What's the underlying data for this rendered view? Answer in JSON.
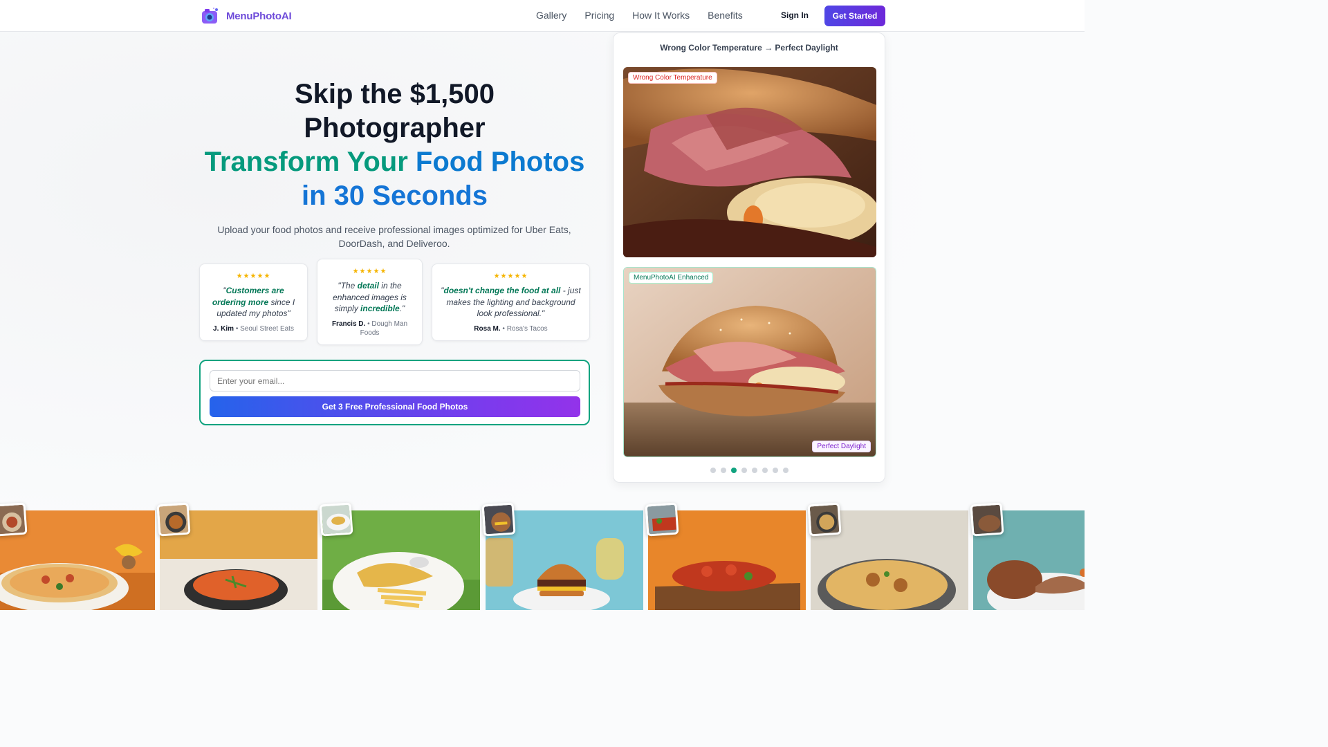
{
  "header": {
    "brand": "MenuPhotoAI",
    "nav": [
      "Gallery",
      "Pricing",
      "How It Works",
      "Benefits"
    ],
    "sign_in": "Sign In",
    "get_started": "Get Started"
  },
  "hero": {
    "line1": "Skip the $1,500",
    "line2": "Photographer",
    "line3a": "Transform Your",
    "line3b": "Food Photos",
    "line4": "in 30 Seconds",
    "subtitle": "Upload your food photos and receive professional images optimized for Uber Eats, DoorDash, and Deliveroo."
  },
  "testimonials": [
    {
      "stars": "★★★★★",
      "q_pre": "\"",
      "q_bold": "Customers are ordering more",
      "q_post": " since I updated my photos\"",
      "name": "J. Kim",
      "business": "Seoul Street Eats"
    },
    {
      "stars": "★★★★★",
      "q_pre": "\"The ",
      "q_bold": "detail",
      "q_mid": " in the enhanced images is simply ",
      "q_bold2": "incredible",
      "q_post": ".\"",
      "name": "Francis D.",
      "business": "Dough Man Foods"
    },
    {
      "stars": "★★★★★",
      "q_pre": "\"",
      "q_bold": "doesn't change the food at all",
      "q_post": " - just makes the lighting and background look professional.\"",
      "name": "Rosa M.",
      "business": "Rosa's Tacos"
    }
  ],
  "signup": {
    "email_placeholder": "Enter your email...",
    "cta": "Get 3 Free Professional Food Photos"
  },
  "compare": {
    "title": "Wrong Color Temperature → Perfect Daylight",
    "before_badge": "Wrong Color Temperature",
    "after_badge": "MenuPhotoAI Enhanced",
    "after_tag": "Perfect Daylight",
    "dots_total": 8,
    "active_dot": 3
  },
  "gallery": [
    "pizza",
    "tomato soup",
    "fish and chips",
    "burger",
    "bruschetta",
    "biryani",
    "roast potato"
  ],
  "colors": {
    "brand": "#6d4ad9",
    "accent_green": "#069a7d",
    "accent_blue": "#1575d6",
    "cta_start": "#2563eb",
    "cta_end": "#9333ea"
  }
}
